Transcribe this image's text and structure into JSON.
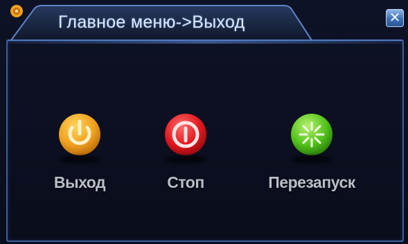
{
  "window": {
    "title": "Главное меню->Выход",
    "close_label": "✕"
  },
  "actions": [
    {
      "label": "Выход",
      "icon": "power-icon",
      "color": "#f0a020"
    },
    {
      "label": "Стоп",
      "icon": "stop-icon",
      "color": "#e2171e"
    },
    {
      "label": "Перезапуск",
      "icon": "restart-icon",
      "color": "#52c21a"
    }
  ],
  "colors": {
    "background": "#0b0e1f",
    "frame": "#3b5f9a",
    "title_text": "#d8e6ff",
    "label_text": "#b9bdc8"
  }
}
